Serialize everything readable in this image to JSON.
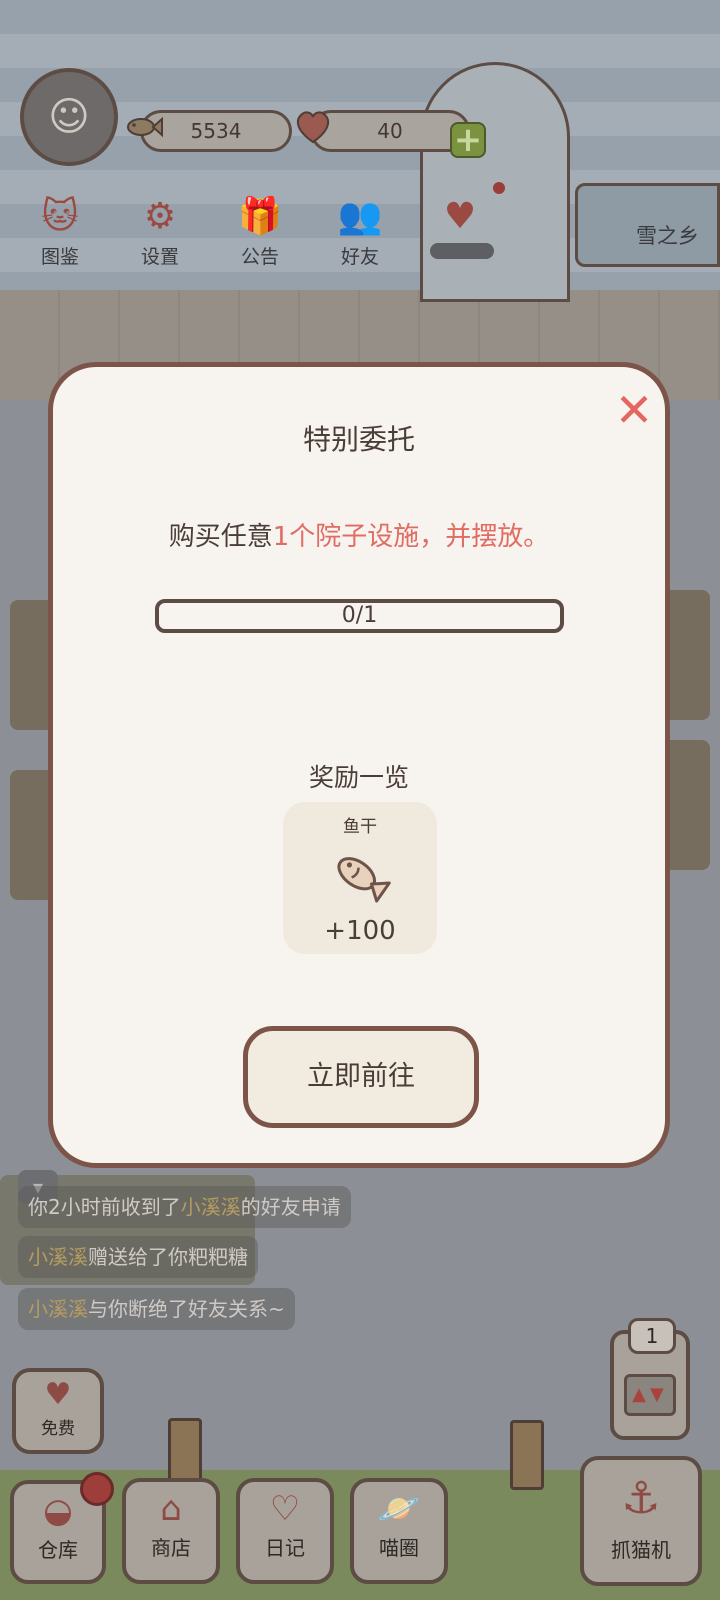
{
  "header": {
    "fish_count": "5534",
    "heart_count": "40"
  },
  "top_menu": [
    {
      "label": "图鉴",
      "icon": "cat-book-icon"
    },
    {
      "label": "设置",
      "icon": "gear-icon"
    },
    {
      "label": "公告",
      "icon": "gift-icon"
    },
    {
      "label": "好友",
      "icon": "friends-icon"
    },
    {
      "label": "",
      "icon": "butterfly-icon"
    }
  ],
  "location_tab": {
    "label": "雪之乡"
  },
  "modal": {
    "title": "特别委托",
    "description_prefix": "购买任意",
    "description_highlight": "1个院子设施，并摆放。",
    "progress_text": "0/1",
    "progress_fraction": 0,
    "reward_heading": "奖励一览",
    "reward": {
      "name": "鱼干",
      "amount": "+100",
      "icon": "fish-icon"
    },
    "go_button": "立即前往"
  },
  "chat": [
    {
      "prefix": "你2小时前收到了",
      "name": "小溪溪",
      "suffix": "的好友申请"
    },
    {
      "prefix": "",
      "name": "小溪溪",
      "suffix": "赠送给了你粑粑糖"
    },
    {
      "prefix": "",
      "name": "小溪溪",
      "suffix": "与你断绝了好友关系~"
    }
  ],
  "bottom_bar": {
    "free_label": "免费",
    "machine_count": "1",
    "items": [
      {
        "label": "仓库",
        "icon": "storage-icon"
      },
      {
        "label": "商店",
        "icon": "shop-icon"
      },
      {
        "label": "日记",
        "icon": "diary-icon"
      },
      {
        "label": "喵圈",
        "icon": "cat-planet-icon"
      },
      {
        "label": "抓猫机",
        "icon": "claw-machine-icon"
      }
    ]
  },
  "colors": {
    "accent_red": "#e06c63",
    "modal_border": "#7d5548",
    "modal_bg": "#f7f3ee"
  }
}
